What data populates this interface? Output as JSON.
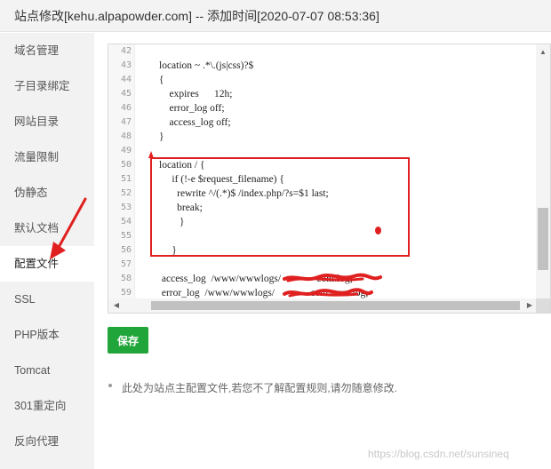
{
  "titlebar": {
    "title": "站点修改[kehu.alpapowder.com] -- 添加时间[2020-07-07 08:53:36]"
  },
  "sidebar": {
    "items": [
      {
        "label": "域名管理"
      },
      {
        "label": "子目录绑定"
      },
      {
        "label": "网站目录"
      },
      {
        "label": "流量限制"
      },
      {
        "label": "伪静态"
      },
      {
        "label": "默认文档"
      },
      {
        "label": "配置文件"
      },
      {
        "label": "SSL"
      },
      {
        "label": "PHP版本"
      },
      {
        "label": "Tomcat"
      },
      {
        "label": "301重定向"
      },
      {
        "label": "反向代理"
      }
    ],
    "active_index": 6
  },
  "editor": {
    "lines": [
      {
        "num": "42",
        "text": ""
      },
      {
        "num": "43",
        "text": "location ~ .*\\.(js|css)?$"
      },
      {
        "num": "44",
        "text": "{"
      },
      {
        "num": "45",
        "text": "    expires      12h;"
      },
      {
        "num": "46",
        "text": "    error_log off;"
      },
      {
        "num": "47",
        "text": "    access_log off;"
      },
      {
        "num": "48",
        "text": "}"
      },
      {
        "num": "49",
        "text": ""
      },
      {
        "num": "50",
        "text": "location / {"
      },
      {
        "num": "51",
        "text": "     if (!-e $request_filename) {"
      },
      {
        "num": "52",
        "text": "       rewrite ^/(.*)$ /index.php/?s=$1 last;"
      },
      {
        "num": "53",
        "text": "       break;"
      },
      {
        "num": "54",
        "text": "        }"
      },
      {
        "num": "55",
        "text": ""
      },
      {
        "num": "56",
        "text": "     }"
      },
      {
        "num": "57",
        "text": ""
      },
      {
        "num": "58",
        "text": " access_log  /www/wwwlogs/              com.log;"
      },
      {
        "num": "59",
        "text": " error_log  /www/wwwlogs/              com.error.log;"
      }
    ]
  },
  "actions": {
    "save_label": "保存"
  },
  "hint": {
    "text": "此处为站点主配置文件,若您不了解配置规则,请勿随意修改."
  },
  "watermark": {
    "text": "https://blog.csdn.net/sunsineq"
  },
  "colors": {
    "accent_green": "#20a53a",
    "annotation_red": "#e02020"
  }
}
